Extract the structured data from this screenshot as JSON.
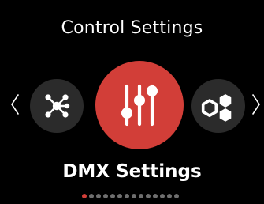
{
  "header": {
    "title": "Control Settings"
  },
  "carousel": {
    "items": [
      {
        "id": "network",
        "icon": "network-hub-icon",
        "label": ""
      },
      {
        "id": "dmx",
        "icon": "sliders-icon",
        "label": "DMX Settings",
        "selected": true
      },
      {
        "id": "effects",
        "icon": "hexagons-icon",
        "label": ""
      }
    ],
    "current_label": "DMX Settings",
    "prev_icon": "chevron-left-icon",
    "next_icon": "chevron-right-icon"
  },
  "pagination": {
    "total": 14,
    "active_index": 0
  },
  "colors": {
    "background": "#000000",
    "accent": "#d23e38",
    "side_item_bg": "#2b2b2b",
    "text": "#ffffff",
    "dot_inactive": "#6e6e6e"
  }
}
